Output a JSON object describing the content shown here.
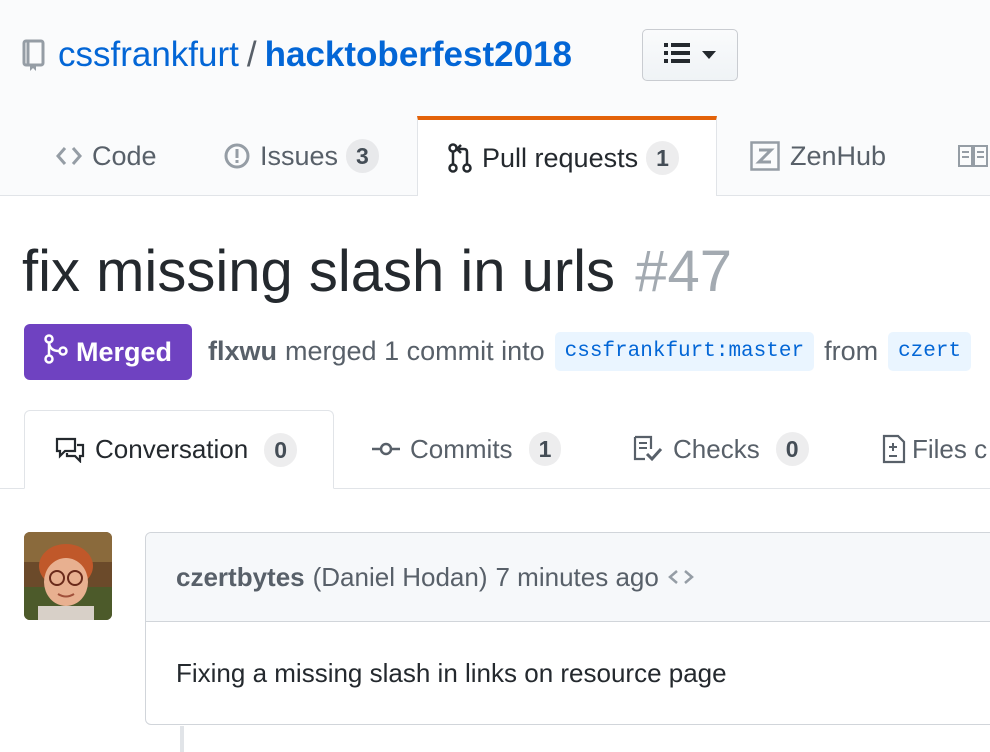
{
  "repo": {
    "owner": "cssfrankfurt",
    "separator": "/",
    "name": "hacktoberfest2018"
  },
  "repo_nav": [
    {
      "label": "Code",
      "icon": "code-icon"
    },
    {
      "label": "Issues",
      "count": "3",
      "icon": "issue-opened-icon"
    },
    {
      "label": "Pull requests",
      "count": "1",
      "icon": "git-pull-request-icon",
      "selected": true
    },
    {
      "label": "ZenHub",
      "icon": "zenhub-icon"
    },
    {
      "label": "",
      "icon": "book-icon"
    }
  ],
  "pr": {
    "title": "fix missing slash in urls",
    "number": "#47",
    "state": "Merged",
    "author": "flxwu",
    "summary": "merged 1 commit into",
    "base_branch": "cssfrankfurt:master",
    "from_word": "from",
    "head_branch": "czert"
  },
  "pr_tabs": [
    {
      "label": "Conversation",
      "count": "0",
      "icon": "comment-discussion-icon",
      "selected": true
    },
    {
      "label": "Commits",
      "count": "1",
      "icon": "git-commit-icon"
    },
    {
      "label": "Checks",
      "count": "0",
      "icon": "checklist-icon"
    },
    {
      "label": "Files c",
      "icon": "diff-icon"
    }
  ],
  "comment": {
    "login": "czertbytes",
    "full_name": "(Daniel Hodan)",
    "time": "7 minutes ago",
    "body": "Fixing a missing slash in links on resource page"
  },
  "colors": {
    "link": "#0366d6",
    "merged": "#6f42c1",
    "selected_tab_accent": "#e36209"
  }
}
